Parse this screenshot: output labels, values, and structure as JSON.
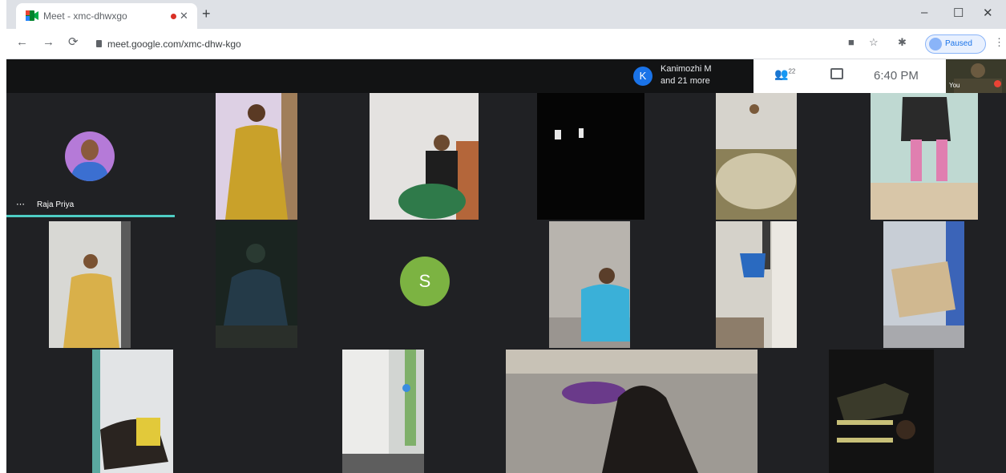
{
  "browser": {
    "tab": {
      "title": "Meet - xmc-dhwxgo"
    },
    "window_controls": {
      "minimize": "–",
      "restore": "☐",
      "close": "✕"
    },
    "toolbar": {
      "url": "meet.google.com/xmc-dhw-kgo",
      "profile_label": "Paused"
    }
  },
  "meet": {
    "presenter": {
      "initial": "K",
      "line1": "Kanimozhi M",
      "line2": "and 21 more"
    },
    "controls": {
      "participants_count": "22",
      "time": "6:40 PM"
    },
    "self_view_label": "You",
    "tiles": [
      {
        "name": "Raja Priya"
      },
      {
        "initial": "S"
      }
    ]
  },
  "colors": {
    "meet_bg": "#202124",
    "speaking_bar": "#4ecdc4",
    "s_avatar": "#7cb342",
    "presenter_avatar": "#1a73e8"
  },
  "icons": [
    "meet-favicon-icon",
    "back-arrow-icon",
    "forward-arrow-icon",
    "reload-icon",
    "lock-icon",
    "camera-icon",
    "star-icon",
    "extensions-icon",
    "people-icon",
    "chat-icon",
    "mic-off-icon"
  ]
}
